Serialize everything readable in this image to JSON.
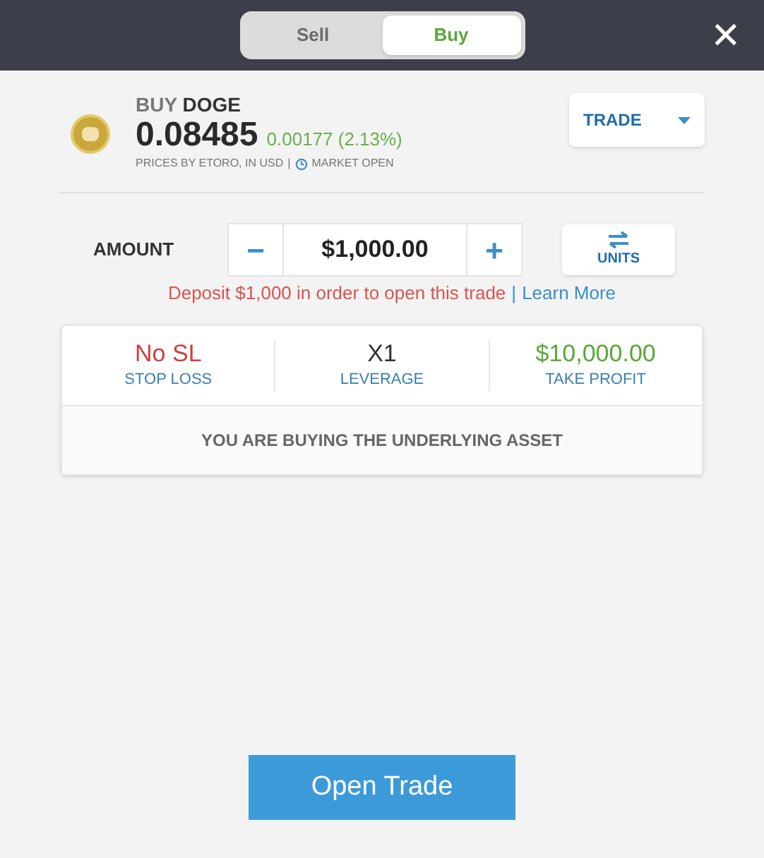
{
  "side_tabs": [
    {
      "label": "Sell",
      "selected": false
    },
    {
      "label": "Buy",
      "selected": true
    }
  ],
  "close": "✕",
  "asset": {
    "action": "BUY",
    "symbol": "DOGE",
    "price": "0.08485",
    "change": "0.00177 (2.13%)",
    "source": "PRICES BY ETORO, IN USD",
    "separator": "|",
    "market_status": "MARKET OPEN"
  },
  "order_type": "TRADE",
  "amount": {
    "label": "AMOUNT",
    "minus": "−",
    "value": "$1,000.00",
    "plus": "+",
    "units_button": "UNITS"
  },
  "notice": {
    "text": "Deposit $1,000 in order to open this trade",
    "separator": "|",
    "link": "Learn More"
  },
  "stats": [
    {
      "value": "No SL",
      "label": "STOP LOSS",
      "kind": "negative"
    },
    {
      "value": "X1",
      "label": "LEVERAGE",
      "kind": "neutral"
    },
    {
      "value": "$10,000.00",
      "label": "TAKE PROFIT",
      "kind": "positive"
    }
  ],
  "asset_note": "YOU ARE BUYING THE UNDERLYING ASSET",
  "submit": "Open Trade"
}
